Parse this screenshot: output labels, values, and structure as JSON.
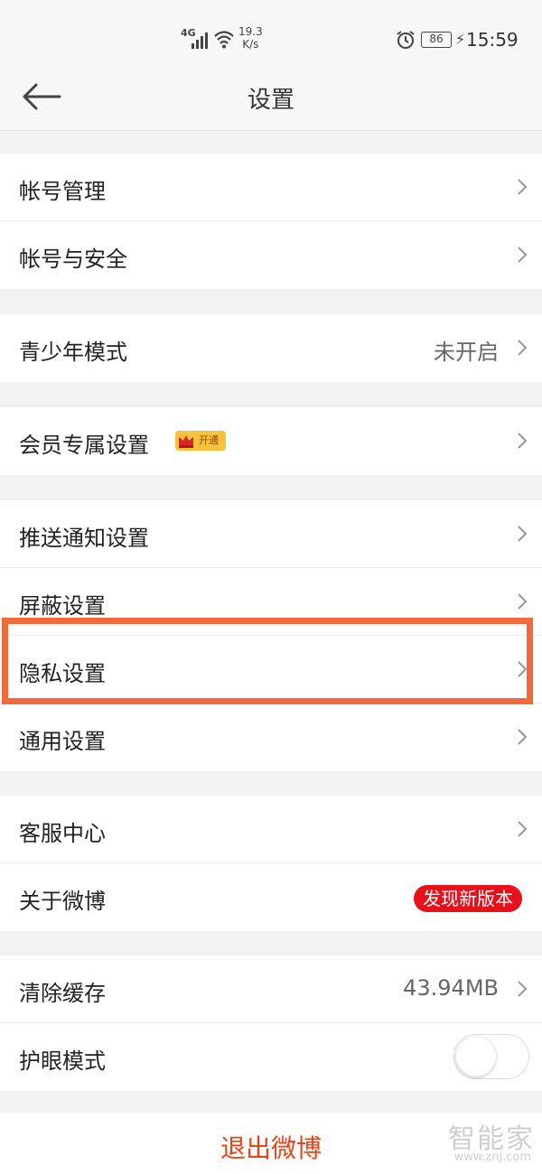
{
  "status_bar": {
    "network": "4G",
    "speed_value": "19.3",
    "speed_unit": "K/s",
    "battery": "86",
    "time": "15:59"
  },
  "header": {
    "title": "设置",
    "back_icon": "arrow-left-icon"
  },
  "groups": {
    "account": {
      "items": [
        {
          "label": "帐号管理"
        },
        {
          "label": "帐号与安全"
        }
      ]
    },
    "youth": {
      "items": [
        {
          "label": "青少年模式",
          "value": "未开启"
        }
      ]
    },
    "vip": {
      "items": [
        {
          "label": "会员专属设置",
          "badge": "开通"
        }
      ]
    },
    "settings": {
      "items": [
        {
          "label": "推送通知设置"
        },
        {
          "label": "屏蔽设置"
        },
        {
          "label": "隐私设置"
        },
        {
          "label": "通用设置"
        }
      ]
    },
    "support": {
      "items": [
        {
          "label": "客服中心"
        },
        {
          "label": "关于微博",
          "badge": "发现新版本"
        }
      ]
    },
    "misc": {
      "items": [
        {
          "label": "清除缓存",
          "value": "43.94MB"
        },
        {
          "label": "护眼模式",
          "toggle": "off"
        }
      ]
    }
  },
  "logout": {
    "label": "退出微博"
  },
  "watermark": {
    "text": "智能家",
    "sub": "www.znj.com"
  },
  "colors": {
    "accent": "#e8431a",
    "badge_red": "#e8101a",
    "highlight": "#f06a3c"
  }
}
